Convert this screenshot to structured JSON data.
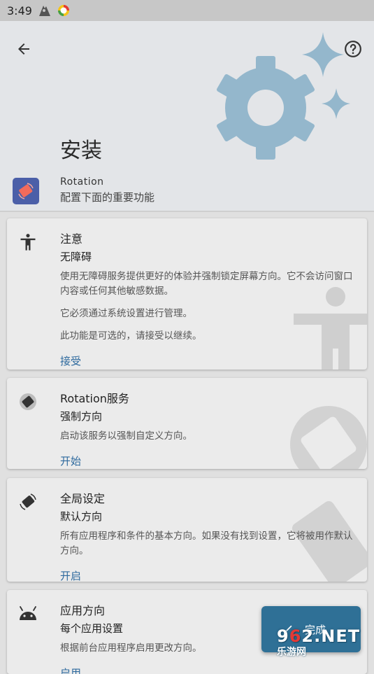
{
  "status_bar": {
    "time": "3:49"
  },
  "header": {
    "title": "安装",
    "app_name": "Rotation",
    "app_subtitle": "配置下面的重要功能"
  },
  "cards": [
    {
      "title": "注意",
      "subtitle": "无障碍",
      "paragraphs": [
        "使用无障碍服务提供更好的体验并强制锁定屏幕方向。它不会访问窗口内容或任何其他敏感数据。",
        "它必须通过系统设置进行管理。",
        "此功能是可选的，请接受以继续。"
      ],
      "action": "接受",
      "icon": "accessibility-icon"
    },
    {
      "title": "Rotation服务",
      "subtitle": "强制方向",
      "paragraphs": [
        "启动该服务以强制自定义方向。"
      ],
      "action": "开始",
      "icon": "rotation-service-icon"
    },
    {
      "title": "全局设定",
      "subtitle": "默认方向",
      "paragraphs": [
        "所有应用程序和条件的基本方向。如果没有找到设置，它将被用作默认方向。"
      ],
      "action": "开启",
      "icon": "global-orientation-icon"
    },
    {
      "title": "应用方向",
      "subtitle": "每个应用设置",
      "paragraphs": [
        "根据前台应用程序启用更改方向。"
      ],
      "action": "启用",
      "icon": "android-icon"
    }
  ],
  "fab": {
    "label": "完成"
  },
  "watermark": {
    "line1_a": "9",
    "line1_b": "6",
    "line1_c": "2",
    "line1_d": ".NET",
    "line2": "乐游网"
  },
  "colors": {
    "accent": "#2e6a9e",
    "fab": "#2f7096",
    "hero_gear": "#94b7cc"
  }
}
